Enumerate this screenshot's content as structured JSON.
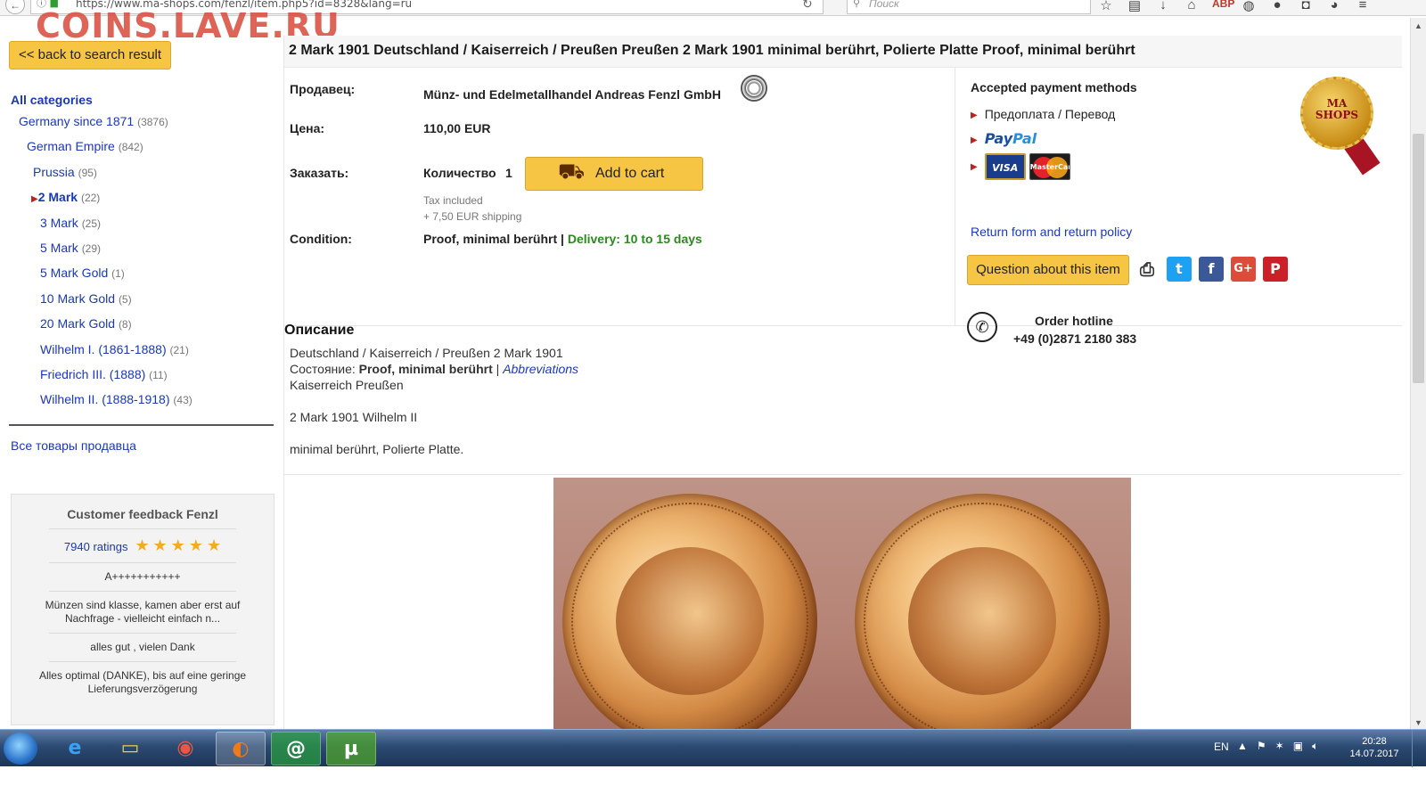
{
  "browser": {
    "url": "https://www.ma-shops.com/fenzl/item.php5?id=8328&lang=ru",
    "search_placeholder": "Поиск",
    "abp_label": "ABP"
  },
  "watermark": "COINS.LAVE.RU",
  "sidebar": {
    "back_label": "<< back to search result",
    "categories_title": "All categories",
    "categories": [
      {
        "label": "Germany since 1871",
        "count": "(3876)"
      },
      {
        "label": "German Empire",
        "count": "(842)"
      },
      {
        "label": "Prussia",
        "count": "(95)"
      },
      {
        "label": "2 Mark",
        "count": "(22)"
      },
      {
        "label": "3 Mark",
        "count": "(25)"
      },
      {
        "label": "5 Mark",
        "count": "(29)"
      },
      {
        "label": "5 Mark Gold",
        "count": "(1)"
      },
      {
        "label": "10 Mark Gold",
        "count": "(5)"
      },
      {
        "label": "20 Mark Gold",
        "count": "(8)"
      },
      {
        "label": "Wilhelm I. (1861-1888)",
        "count": "(21)"
      },
      {
        "label": "Friedrich III. (1888)",
        "count": "(11)"
      },
      {
        "label": "Wilhelm II. (1888-1918)",
        "count": "(43)"
      }
    ],
    "seller_items": "Все товары продавца",
    "feedback": {
      "title": "Customer feedback Fenzl",
      "ratings": "7940 ratings",
      "comments": [
        "A+++++++++++",
        "Münzen sind klasse, kamen aber erst auf Nachfrage - vielleicht einfach n...",
        "alles gut , vielen Dank",
        "Alles optimal (DANKE), bis auf eine geringe Lieferungsverzögerung"
      ]
    }
  },
  "item": {
    "title": "2 Mark 1901 Deutschland / Kaiserreich / Preußen Preußen 2 Mark 1901 minimal berührt, Polierte Platte Proof, minimal berührt",
    "seller_label": "Продавец:",
    "seller": "Münz- und Edelmetallhandel Andreas Fenzl GmbH",
    "price_label": "Цена:",
    "price": "110,00 EUR",
    "order_label": "Заказать:",
    "quantity_label": "Количество",
    "quantity": "1",
    "add_to_cart": "Add to cart",
    "tax": "Tax included",
    "shipping": "+ 7,50 EUR shipping",
    "condition_label": "Condition:",
    "condition": "Proof, minimal berührt",
    "separator": " | ",
    "delivery": "Delivery: 10 to 15 days"
  },
  "payment": {
    "title": "Accepted payment methods",
    "method1": "Предоплата / Перевод",
    "paypal_a": "Pay",
    "paypal_b": "Pal",
    "visa": "VISA",
    "mastercard": "MasterCard",
    "return_link": "Return form and return policy",
    "question_btn": "Question about this item",
    "hotline_label": "Order hotline",
    "hotline_number": "+49 (0)2871 2180 383"
  },
  "badge": {
    "line1": "MA",
    "line2": "SHOPS"
  },
  "description": {
    "title": "Описание",
    "line1": "Deutschland / Kaiserreich / Preußen 2 Mark 1901",
    "state_label": "Состояние: ",
    "state_value": "Proof, minimal berührt",
    "state_sep": " | ",
    "abbreviations": "Abbreviations",
    "line3": "Kaiserreich Preußen",
    "line4": "2 Mark 1901 Wilhelm II",
    "line5": "minimal berührt, Polierte Platte."
  },
  "taskbar": {
    "lang": "EN",
    "time": "20:28",
    "date": "14.07.2017"
  },
  "colors": {
    "accent_button": "#f6c544",
    "link": "#1a38b8",
    "delivery_green": "#2b8a1e",
    "watermark_red": "#d94a3a"
  }
}
